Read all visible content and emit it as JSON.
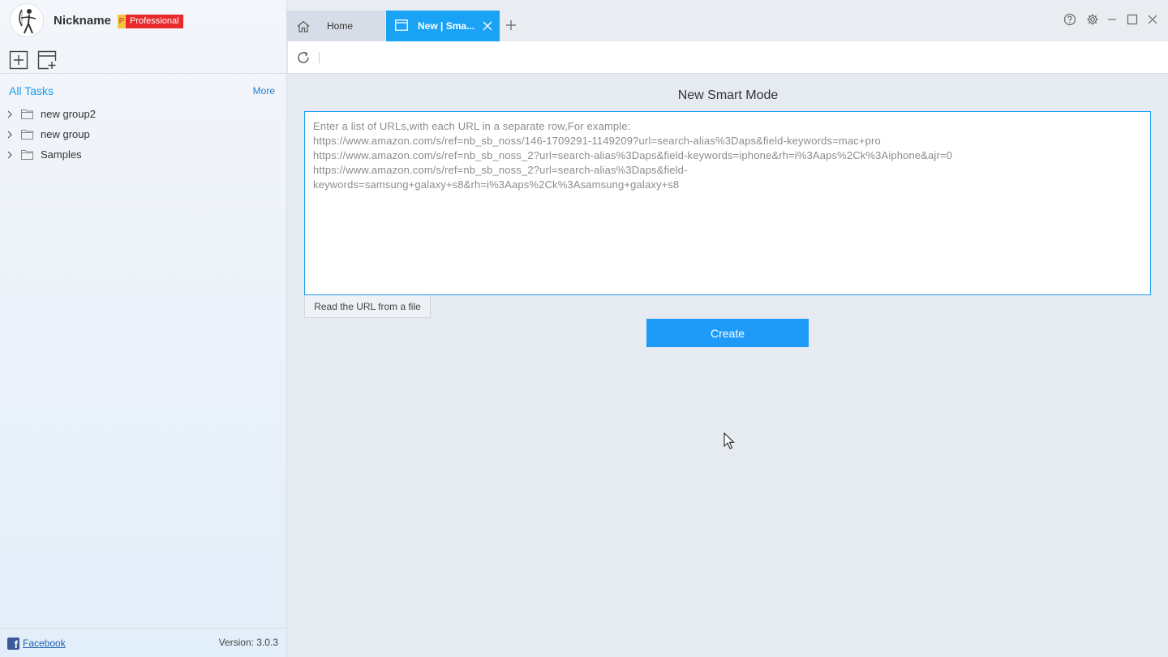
{
  "profile": {
    "nickname": "Nickname",
    "badge_letter": "P",
    "badge_label": "Professional"
  },
  "sidebar": {
    "toolbar": {
      "new_task_icon": "plus-box-icon",
      "new_group_icon": "add-panel-icon"
    },
    "tasks_title": "All Tasks",
    "more_label": "More",
    "items": [
      {
        "label": "new group2"
      },
      {
        "label": "new group"
      },
      {
        "label": "Samples"
      }
    ],
    "footer": {
      "facebook_label": "Facebook",
      "version": "Version: 3.0.3"
    }
  },
  "tabs": [
    {
      "label": "Home",
      "icon": "home-icon",
      "active": false
    },
    {
      "label": "New | Sma...",
      "icon": "window-icon",
      "active": true
    }
  ],
  "main": {
    "title": "New Smart Mode",
    "url_placeholder": "Enter a list of URLs,with each URL in a separate row,For example:\nhttps://www.amazon.com/s/ref=nb_sb_noss/146-1709291-1149209?url=search-alias%3Daps&field-keywords=mac+pro\nhttps://www.amazon.com/s/ref=nb_sb_noss_2?url=search-alias%3Daps&field-keywords=iphone&rh=i%3Aaps%2Ck%3Aiphone&ajr=0\nhttps://www.amazon.com/s/ref=nb_sb_noss_2?url=search-alias%3Daps&field-\nkeywords=samsung+galaxy+s8&rh=i%3Aaps%2Ck%3Asamsung+galaxy+s8",
    "read_file_label": "Read the URL from a file",
    "create_label": "Create"
  },
  "colors": {
    "accent": "#1e9bf8",
    "badge_red": "#e8282b",
    "badge_yellow": "#f5c342"
  }
}
